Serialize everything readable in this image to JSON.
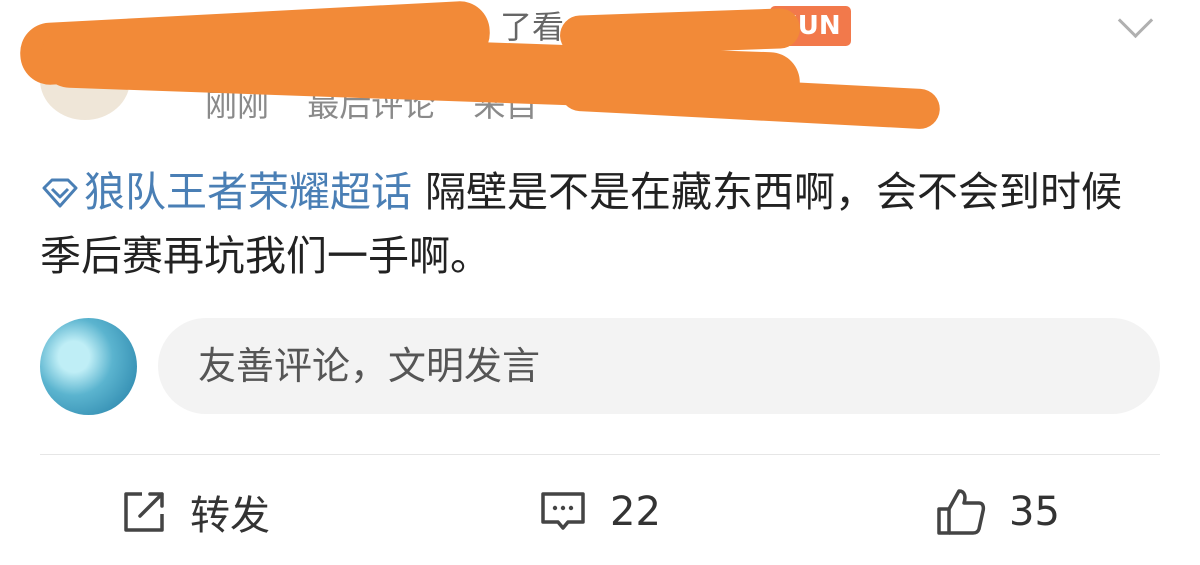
{
  "header": {
    "name_fragment": "了看",
    "badge": "FUN",
    "meta_items": [
      "刚刚",
      "最后评论",
      "来自"
    ]
  },
  "post": {
    "topic": "狼队王者荣耀超话",
    "text": "隔壁是不是在藏东西啊，会不会到时候季后赛再坑我们一手啊。"
  },
  "comment": {
    "placeholder": "友善评论，文明发言"
  },
  "actions": {
    "repost_label": "转发",
    "comment_count": "22",
    "like_count": "35"
  },
  "colors": {
    "topic": "#4a7fb5",
    "redaction": "#f28a38",
    "badge": "#f2794b"
  },
  "icons": [
    "chevron-down-icon",
    "super-topic-icon",
    "repost-icon",
    "comment-icon",
    "like-icon"
  ]
}
